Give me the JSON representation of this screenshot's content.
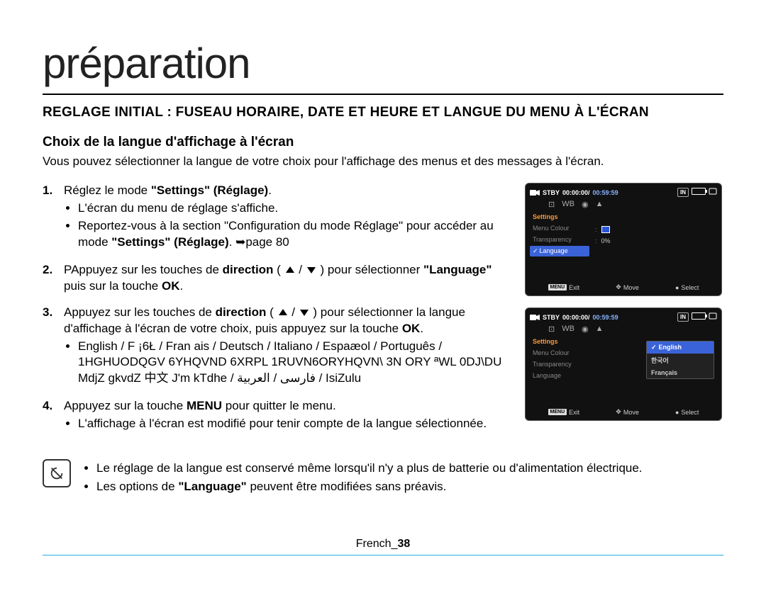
{
  "title": "préparation",
  "section_heading": "REGLAGE INITIAL : FUSEAU HORAIRE, DATE ET HEURE ET LANGUE DU MENU À L'ÉCRAN",
  "sub_heading": "Choix de la langue d'affichage à l'écran",
  "intro": "Vous pouvez sélectionner la langue de votre choix pour l'affichage des menus et des messages à  l'écran.",
  "steps": {
    "s1_lead": "Réglez le mode ",
    "s1_bold": "\"Settings\" (Réglage)",
    "s1_tail": ".",
    "s1_b1": "L'écran du menu de réglage s'affiche.",
    "s1_b2_a": "Reportez-vous à la section \"Configuration du mode Réglage\" pour accéder au mode ",
    "s1_b2_bold": "\"Settings\" (Réglage)",
    "s1_b2_b": ". ➥page 80",
    "s2_a": "PAppuyez sur les touches de ",
    "s2_dir": "direction",
    "s2_b": " (",
    "s2_c": ") pour sélectionner ",
    "s2_lang": "\"Language\"",
    "s2_d": " puis sur la touche ",
    "s2_ok": "OK",
    "s2_e": ".",
    "s3_a": "Appuyez sur les touches de ",
    "s3_dir": "direction",
    "s3_b": " (",
    "s3_c": ") pour sélectionner la langue d'affichage à l'écran de votre choix, puis appuyez sur la touche ",
    "s3_ok": "OK",
    "s3_d": ".",
    "s3_bullet": "English / F ¡6Ł / Fran ais / Deutsch / Italiano / Espaæol / Português / 1HGHUODQGV 6YHQVND 6XRPL 1RUVN6ORYHQVN\\ 3N ORY ªWL 0DJ\\DU MdjZ gkvdZ 中文 J'm kTdhe / فارسی / العربية / IsiZulu",
    "s4_a": "Appuyez sur la touche ",
    "s4_menu": "MENU",
    "s4_b": " pour quitter le menu.",
    "s4_bullet": "L'affichage à l'écran est modifié pour tenir compte de la langue sélectionnée."
  },
  "notes": {
    "n1": "Le réglage de la langue est conservé même lorsqu'il n'y a plus de batterie ou d'alimentation électrique.",
    "n2_a": "Les options de ",
    "n2_bold": "\"Language\"",
    "n2_b": " peuvent être modifiées sans préavis."
  },
  "cam": {
    "stby": "STBY",
    "tc1": "00:00:00/",
    "tc2": "00:59:59",
    "in_badge": "IN",
    "sidebar_title": "Settings",
    "menu_colour": "Menu Colour",
    "transparency": "Transparency",
    "language": "Language",
    "lang_check": "✓",
    "pct": "0%",
    "menu_label": "MENU",
    "exit": "Exit",
    "move": "Move",
    "select": "Select",
    "opt_en": "English",
    "opt_ko": "한국어",
    "opt_fr": "Français"
  },
  "footer_label": "French_",
  "footer_page": "38"
}
